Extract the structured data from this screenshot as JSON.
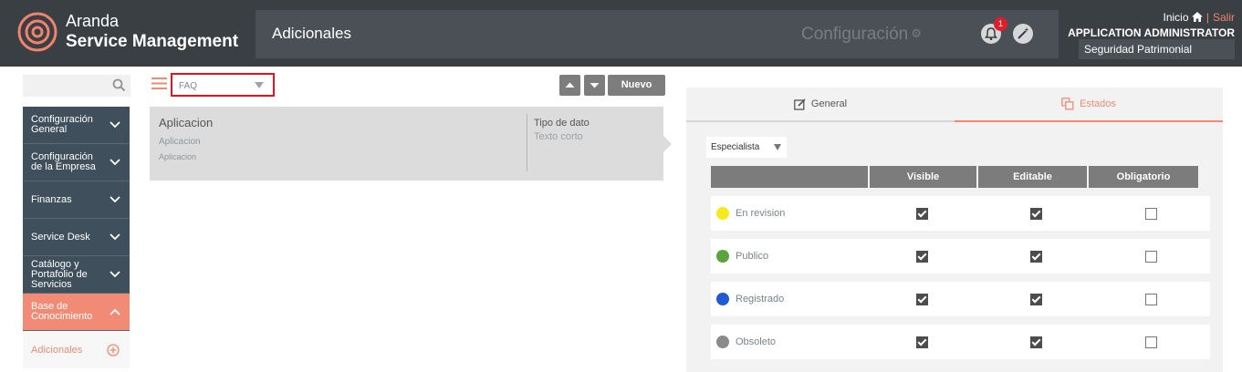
{
  "header": {
    "brand_line1": "Aranda",
    "brand_line2": "Service Management",
    "page_title": "Adicionales",
    "config_label": "Configuración",
    "notification_count": "1",
    "inicio": "Inicio",
    "salir": "Salir",
    "user_name": "APPLICATION ADMINISTRATOR",
    "user_department": "Seguridad Patrimonial"
  },
  "sidebar": {
    "items": [
      {
        "label": "Configuración General"
      },
      {
        "label": "Configuración de la Empresa"
      },
      {
        "label": "Finanzas"
      },
      {
        "label": "Service Desk"
      },
      {
        "label": "Catálogo y Portafolio de Servicios"
      },
      {
        "label": "Base de Conocimiento"
      }
    ],
    "sub_item": "Adicionales"
  },
  "toolbar": {
    "filter_value": "FAQ",
    "new_label": "Nuevo"
  },
  "card": {
    "title": "Aplicacion",
    "subtitle1": "Aplicacion",
    "subtitle2": "Aplicacion",
    "type_label": "Tipo de dato",
    "type_value": "Texto corto"
  },
  "panel": {
    "tab_general": "General",
    "tab_estados": "Estados",
    "role": "Especialista",
    "columns": [
      "Visible",
      "Editable",
      "Obligatorio"
    ],
    "rows": [
      {
        "name": "En revision",
        "color": "#f5ea1a",
        "visible": true,
        "editable": true,
        "obligatorio": false
      },
      {
        "name": "Publico",
        "color": "#5aa53f",
        "visible": true,
        "editable": true,
        "obligatorio": false
      },
      {
        "name": "Registrado",
        "color": "#1e5bd2",
        "visible": true,
        "editable": true,
        "obligatorio": false
      },
      {
        "name": "Obsoleto",
        "color": "#8a8a8a",
        "visible": true,
        "editable": true,
        "obligatorio": false
      }
    ]
  },
  "colors": {
    "accent": "#f08a75",
    "header_bg": "#3a3f44",
    "sidebar_bg": "#3f4f5b"
  },
  "icons": [
    "aranda-logo-icon",
    "gear-icon",
    "bell-icon",
    "wand-icon",
    "home-icon",
    "search-icon",
    "hamburger-icon",
    "arrow-up-icon",
    "arrow-down-icon",
    "edit-icon",
    "copy-icon",
    "plus-circle-icon",
    "chevron-down-icon",
    "chevron-up-icon"
  ]
}
